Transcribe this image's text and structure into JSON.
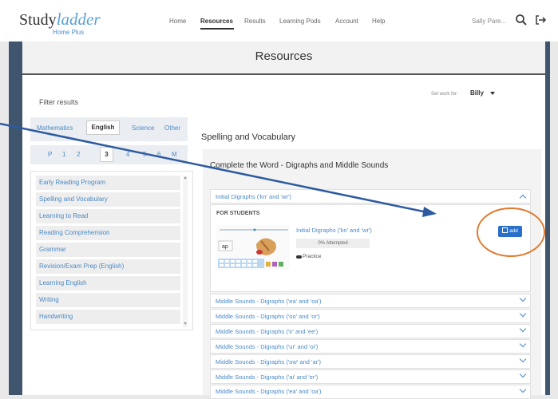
{
  "brand": {
    "name_part1": "Study",
    "name_part2": "ladder",
    "tagline": "Home Plus"
  },
  "nav": {
    "items": [
      "Home",
      "Resources",
      "Results",
      "Learning Pods",
      "Account",
      "Help"
    ],
    "active": "Resources"
  },
  "user": {
    "name": "Sally Pare..."
  },
  "icons": {
    "search": "search-icon",
    "logout": "logout-icon"
  },
  "page": {
    "title": "Resources"
  },
  "set_work": {
    "label": "Set work for:",
    "value": "Billy"
  },
  "filter": {
    "label": "Filter results",
    "subjects": [
      "Mathematics",
      "English",
      "Science",
      "Other"
    ],
    "active_subject": "English",
    "grades": [
      "P",
      "1",
      "2",
      "3",
      "4",
      "5",
      "6",
      "M"
    ],
    "active_grade": "3",
    "categories": [
      "Early Reading Program",
      "Spelling and Vocabulary",
      "Learning to Read",
      "Reading Comprehension",
      "Grammar",
      "Revision/Exam Prep (English)",
      "Learning English",
      "Writing",
      "Handwriting"
    ]
  },
  "content": {
    "section_heading": "Spelling and Vocabulary",
    "topic_title": "Complete the Word - Digraphs and Middle Sounds",
    "open_item": {
      "label": "Initial Digraphs ('kn' and 'wr')",
      "for_students": "FOR STUDENTS",
      "resource_title": "Initial Digraphs ('kn' and 'wr')",
      "status": "0% Attempted",
      "type": "Practice",
      "add_label": "add"
    },
    "items": [
      "Middle Sounds - Digraphs ('ea' and 'oa')",
      "Middle Sounds - Digraphs ('oo' and 'or')",
      "Middle Sounds - Digraphs ('ir' and 'ee')",
      "Middle Sounds - Digraphs ('ur' and 'oi')",
      "Middle Sounds - Digraphs ('ow' and 'ar')",
      "Middle Sounds - Digraphs ('ai' and 'er')",
      "Middle Sounds - Digraphs ('ea' and 'oa')"
    ]
  },
  "colors": {
    "brand_blue": "#5aa0d8",
    "link_blue": "#4a8ac8",
    "frame": "#3f556e",
    "add_button": "#2a70c8",
    "annotation": "#e07a2e",
    "arrow": "#2c5aa0"
  }
}
